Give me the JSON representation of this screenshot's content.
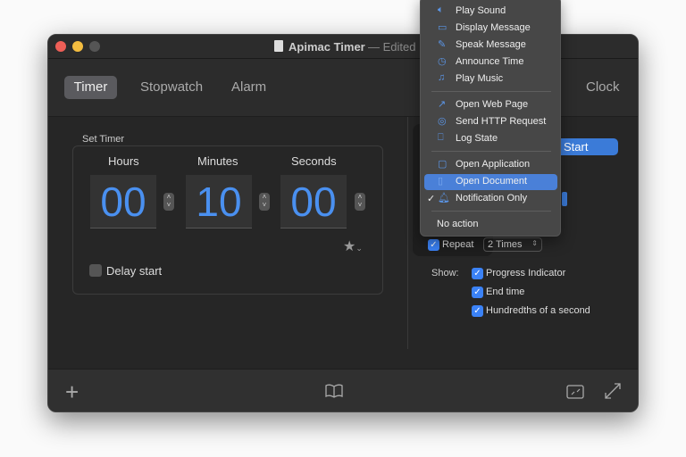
{
  "window": {
    "title": "Apimac Timer",
    "edited": "— Edited"
  },
  "tabs": [
    {
      "label": "Timer"
    },
    {
      "label": "Stopwatch"
    },
    {
      "label": "Alarm"
    },
    {
      "label": "Clock"
    }
  ],
  "set_timer": {
    "label": "Set Timer",
    "hours_label": "Hours",
    "minutes_label": "Minutes",
    "seconds_label": "Seconds",
    "hours": "00",
    "minutes": "10",
    "seconds": "00",
    "delay_start": "Delay start"
  },
  "right": {
    "start": "Start",
    "repeat": "Repeat",
    "repeat_value": "2 Times",
    "show": "Show:",
    "options": [
      "Progress Indicator",
      "End time",
      "Hundredths of a second"
    ]
  },
  "menu": {
    "items": [
      "Play Sound",
      "Display Message",
      "Speak Message",
      "Announce Time",
      "Play Music",
      "Open Web Page",
      "Send HTTP Request",
      "Log State",
      "Open Application",
      "Open Document",
      "Notification Only",
      "No action"
    ],
    "checked": "✓",
    "highlight_color": "#4a80d8"
  },
  "colors": {
    "accent": "#3b82f6",
    "digit": "#4a90f0"
  }
}
